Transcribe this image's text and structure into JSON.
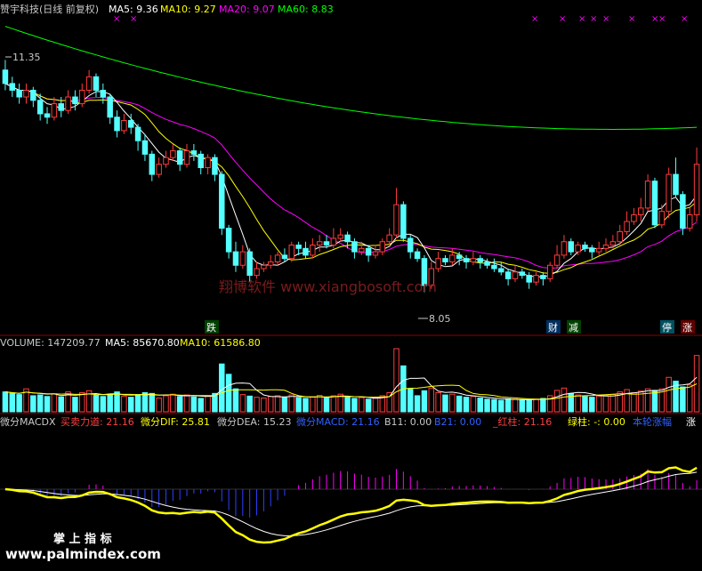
{
  "price_panel": {
    "header": {
      "title": "赞宇科技(日线 前复权)",
      "ma5_label": "MA5: 9.36",
      "ma10_label": "MA10: 9.27",
      "ma20_label": "MA20: 9.07",
      "ma60_label": "MA60: 8.83"
    },
    "annotations": {
      "high_price": "11.35",
      "low_price": "8.05",
      "watermark": "翔博软件 www.xiangbosoft.com"
    },
    "markers": {
      "die": "跌",
      "cai": "财",
      "jian": "减",
      "ting": "停",
      "zhang": "涨"
    }
  },
  "volume_panel": {
    "header": {
      "volume_label": "VOLUME: 147209.77",
      "ma5_label": "MA5: 85670.80",
      "ma10_label": "MA10: 61586.80"
    }
  },
  "macd_panel": {
    "header": {
      "name": "微分MACDX",
      "buy_sell_force": "买卖力道: 21.16",
      "dif": "微分DIF: 25.81",
      "dea": "微分DEA: 15.23",
      "macd": "微分MACD: 21.16",
      "b11": "B11: 0.00",
      "b21": "B21: 0.00",
      "red_bar": "_红柱: 21.16",
      "green_bar": "绿柱: -: 0.00",
      "signal": "本轮涨幅",
      "trailing": "涨"
    }
  },
  "footer": {
    "brand": "掌 上 指 标",
    "url": "www.palmindex.com"
  },
  "colors": {
    "background": "#000000",
    "up_candle": "#ff3b3b",
    "down_candle": "#54ffff",
    "ma5": "#ffffff",
    "ma10": "#ffff00",
    "ma20": "#ff00ff",
    "ma60": "#00ff00",
    "grid": "#8b0000",
    "text": "#c8c8c8",
    "macd_line": "#ffff00",
    "dea_line": "#ffffff"
  },
  "chart_data": [
    {
      "type": "candlestick",
      "title": "赞宇科技(日线 前复权)",
      "ylim": [
        7.6,
        12.0
      ],
      "moving_averages": {
        "MA5": 9.36,
        "MA10": 9.27,
        "MA20": 9.07,
        "MA60": 8.83
      },
      "labeled_points": {
        "high": 11.35,
        "low": 8.05
      },
      "candles": [
        [
          11.25,
          11.05,
          11.4,
          10.95
        ],
        [
          11.05,
          10.95,
          11.15,
          10.85
        ],
        [
          10.95,
          10.85,
          11.05,
          10.75
        ],
        [
          10.85,
          10.95,
          11.05,
          10.75
        ],
        [
          10.95,
          10.8,
          11.0,
          10.7
        ],
        [
          10.8,
          10.6,
          10.9,
          10.5
        ],
        [
          10.6,
          10.55,
          10.7,
          10.45
        ],
        [
          10.55,
          10.75,
          10.85,
          10.5
        ],
        [
          10.75,
          10.65,
          10.85,
          10.55
        ],
        [
          10.65,
          10.85,
          10.95,
          10.6
        ],
        [
          10.85,
          10.75,
          10.95,
          10.65
        ],
        [
          10.75,
          10.95,
          11.05,
          10.7
        ],
        [
          10.95,
          11.15,
          11.25,
          10.9
        ],
        [
          11.15,
          10.95,
          11.2,
          10.85
        ],
        [
          10.95,
          10.85,
          11.05,
          10.75
        ],
        [
          10.85,
          10.55,
          10.9,
          10.45
        ],
        [
          10.55,
          10.35,
          10.65,
          10.25
        ],
        [
          10.35,
          10.5,
          10.6,
          10.3
        ],
        [
          10.5,
          10.4,
          10.6,
          10.3
        ],
        [
          10.4,
          10.2,
          10.45,
          10.05
        ],
        [
          10.2,
          10.0,
          10.3,
          9.9
        ],
        [
          10.0,
          9.7,
          10.05,
          9.6
        ],
        [
          9.7,
          9.85,
          9.95,
          9.65
        ],
        [
          9.85,
          9.95,
          10.05,
          9.8
        ],
        [
          9.95,
          10.05,
          10.15,
          9.9
        ],
        [
          10.05,
          9.85,
          10.1,
          9.75
        ],
        [
          9.85,
          10.05,
          10.15,
          9.8
        ],
        [
          10.05,
          10.0,
          10.15,
          9.9
        ],
        [
          10.0,
          9.8,
          10.05,
          9.7
        ],
        [
          9.8,
          9.95,
          10.0,
          9.7
        ],
        [
          9.95,
          9.7,
          10.0,
          9.6
        ],
        [
          9.7,
          8.9,
          9.75,
          8.8
        ],
        [
          8.9,
          8.55,
          8.95,
          8.45
        ],
        [
          8.55,
          8.35,
          8.7,
          8.25
        ],
        [
          8.35,
          8.55,
          8.65,
          8.3
        ],
        [
          8.55,
          8.2,
          8.6,
          8.1
        ],
        [
          8.2,
          8.3,
          8.4,
          8.15
        ],
        [
          8.3,
          8.35,
          8.4,
          8.25
        ],
        [
          8.35,
          8.4,
          8.5,
          8.3
        ],
        [
          8.4,
          8.5,
          8.55,
          8.35
        ],
        [
          8.5,
          8.45,
          8.6,
          8.4
        ],
        [
          8.45,
          8.65,
          8.7,
          8.4
        ],
        [
          8.65,
          8.6,
          8.7,
          8.5
        ],
        [
          8.6,
          8.5,
          8.7,
          8.45
        ],
        [
          8.5,
          8.65,
          8.75,
          8.45
        ],
        [
          8.65,
          8.7,
          8.8,
          8.55
        ],
        [
          8.7,
          8.65,
          8.8,
          8.6
        ],
        [
          8.65,
          8.75,
          8.9,
          8.6
        ],
        [
          8.75,
          8.8,
          8.9,
          8.7
        ],
        [
          8.8,
          8.7,
          8.85,
          8.6
        ],
        [
          8.7,
          8.55,
          8.75,
          8.45
        ],
        [
          8.55,
          8.6,
          8.7,
          8.5
        ],
        [
          8.6,
          8.5,
          8.65,
          8.4
        ],
        [
          8.5,
          8.55,
          8.65,
          8.45
        ],
        [
          8.55,
          8.7,
          8.75,
          8.5
        ],
        [
          8.7,
          8.8,
          8.9,
          8.65
        ],
        [
          8.8,
          9.25,
          9.5,
          8.75
        ],
        [
          9.25,
          8.75,
          9.3,
          8.7
        ],
        [
          8.75,
          8.55,
          8.8,
          8.45
        ],
        [
          8.55,
          8.45,
          8.6,
          8.4
        ],
        [
          8.45,
          8.05,
          8.5,
          7.95
        ],
        [
          8.05,
          8.3,
          8.4,
          8.0
        ],
        [
          8.3,
          8.45,
          8.55,
          8.25
        ],
        [
          8.45,
          8.4,
          8.5,
          8.35
        ],
        [
          8.4,
          8.5,
          8.6,
          8.35
        ],
        [
          8.5,
          8.45,
          8.55,
          8.35
        ],
        [
          8.45,
          8.4,
          8.5,
          8.3
        ],
        [
          8.4,
          8.45,
          8.55,
          8.35
        ],
        [
          8.45,
          8.4,
          8.5,
          8.3
        ],
        [
          8.4,
          8.35,
          8.45,
          8.3
        ],
        [
          8.35,
          8.3,
          8.45,
          8.25
        ],
        [
          8.3,
          8.25,
          8.4,
          8.2
        ],
        [
          8.25,
          8.15,
          8.3,
          8.05
        ],
        [
          8.15,
          8.25,
          8.35,
          8.1
        ],
        [
          8.25,
          8.2,
          8.3,
          8.15
        ],
        [
          8.2,
          8.1,
          8.25,
          8.0
        ],
        [
          8.1,
          8.2,
          8.25,
          8.05
        ],
        [
          8.2,
          8.15,
          8.25,
          8.05
        ],
        [
          8.15,
          8.35,
          8.4,
          8.1
        ],
        [
          8.35,
          8.5,
          8.65,
          8.3
        ],
        [
          8.5,
          8.7,
          8.8,
          8.45
        ],
        [
          8.7,
          8.55,
          8.75,
          8.5
        ],
        [
          8.55,
          8.65,
          8.7,
          8.5
        ],
        [
          8.65,
          8.6,
          8.7,
          8.55
        ],
        [
          8.6,
          8.55,
          8.65,
          8.45
        ],
        [
          8.55,
          8.6,
          8.7,
          8.5
        ],
        [
          8.6,
          8.65,
          8.75,
          8.55
        ],
        [
          8.65,
          8.7,
          8.8,
          8.6
        ],
        [
          8.7,
          8.85,
          8.95,
          8.65
        ],
        [
          8.85,
          9.0,
          9.15,
          8.8
        ],
        [
          9.0,
          9.1,
          9.2,
          8.95
        ],
        [
          9.1,
          9.2,
          9.35,
          9.0
        ],
        [
          9.2,
          9.6,
          9.7,
          9.15
        ],
        [
          9.6,
          8.95,
          9.65,
          8.9
        ],
        [
          8.95,
          9.15,
          9.25,
          8.9
        ],
        [
          9.15,
          9.7,
          9.8,
          9.05
        ],
        [
          9.7,
          9.4,
          9.95,
          9.35
        ],
        [
          9.4,
          8.9,
          9.45,
          8.8
        ],
        [
          8.9,
          9.1,
          9.2,
          8.85
        ],
        [
          9.1,
          9.85,
          10.1,
          9.0
        ]
      ]
    },
    {
      "type": "bar",
      "title": "VOLUME",
      "series": [
        {
          "name": "VOLUME",
          "values": [
            52000,
            48000,
            45000,
            60000,
            42000,
            44000,
            40000,
            47000,
            39000,
            52000,
            38000,
            50000,
            55000,
            43000,
            40000,
            46000,
            52000,
            41000,
            38000,
            45000,
            50000,
            48000,
            36000,
            42000,
            46000,
            40000,
            44000,
            39000,
            35000,
            42000,
            48000,
            125000,
            98000,
            60000,
            45000,
            41000,
            38000,
            36000,
            40000,
            42000,
            38000,
            44000,
            37000,
            35000,
            39000,
            43000,
            36000,
            42000,
            46000,
            38000,
            35000,
            37000,
            33000,
            35000,
            42000,
            50000,
            165000,
            120000,
            60000,
            42000,
            55000,
            62000,
            50000,
            44000,
            46000,
            41000,
            38000,
            40000,
            36000,
            33000,
            32000,
            30000,
            34000,
            33000,
            31000,
            30000,
            33000,
            35000,
            42000,
            56000,
            62000,
            48000,
            44000,
            40000,
            38000,
            41000,
            43000,
            45000,
            52000,
            58000,
            50000,
            54000,
            60000,
            56000,
            60000,
            90000,
            80000,
            65000,
            70000,
            147209.77
          ]
        },
        {
          "name": "MA5",
          "values": [
            85670.8
          ]
        },
        {
          "name": "MA10",
          "values": [
            61586.8
          ]
        }
      ]
    },
    {
      "type": "line",
      "title": "微分MACDX",
      "series": [
        {
          "name": "微分DIF",
          "values": [
            25.81
          ]
        },
        {
          "name": "微分DEA",
          "values": [
            15.23
          ]
        },
        {
          "name": "微分MACD",
          "values": [
            21.16
          ]
        },
        {
          "name": "买卖力道",
          "values": [
            21.16
          ]
        },
        {
          "name": "B11",
          "values": [
            0.0
          ]
        },
        {
          "name": "B21",
          "values": [
            0.0
          ]
        }
      ]
    }
  ]
}
